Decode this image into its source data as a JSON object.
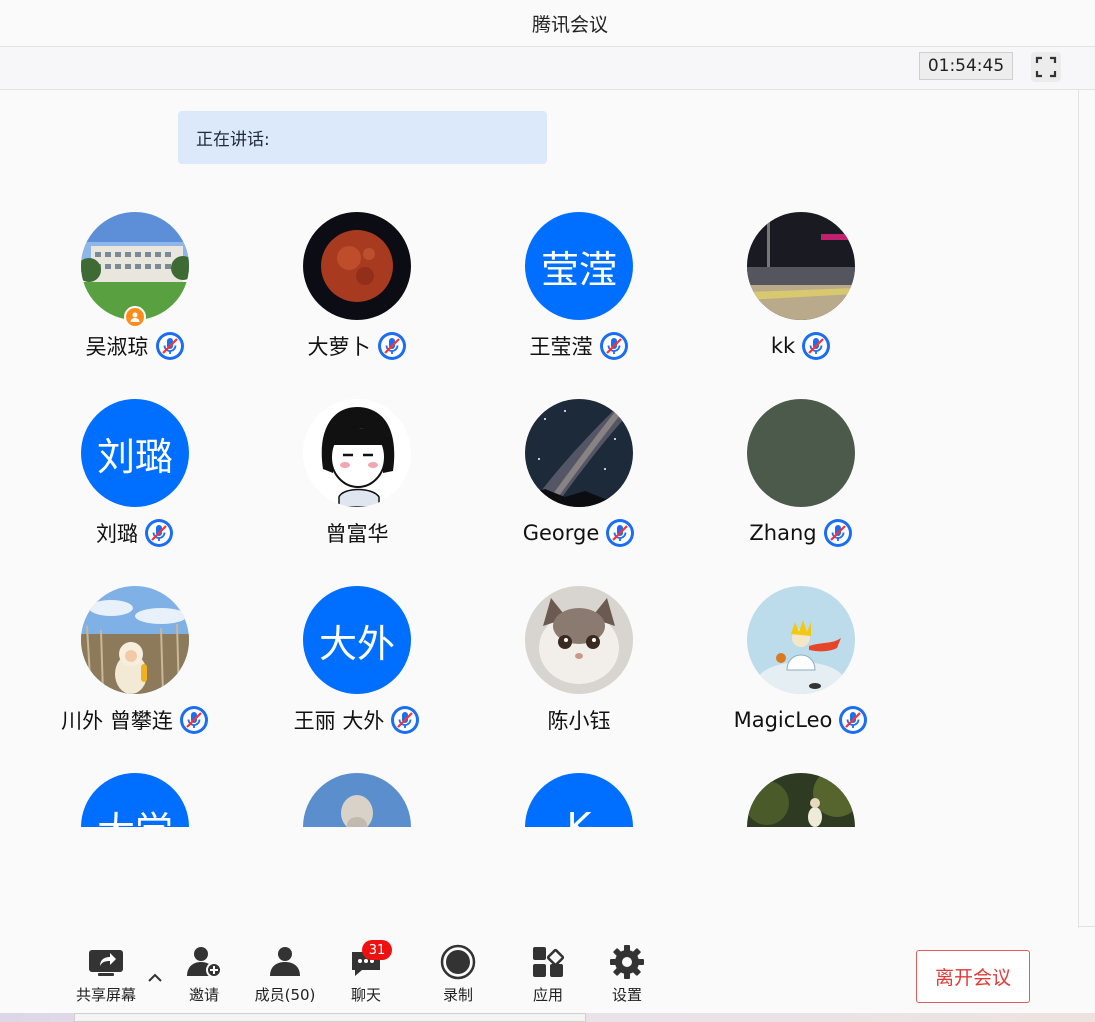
{
  "window": {
    "title": "腾讯会议"
  },
  "topbar": {
    "timer": "01:54:45"
  },
  "speaking": {
    "label": "正在讲话:"
  },
  "participants": [
    {
      "name": "吴淑琼",
      "avatar": "building-photo",
      "muted": true,
      "host": true
    },
    {
      "name": "大萝卜",
      "avatar": "red-moon-photo",
      "muted": true
    },
    {
      "name": "王莹滢",
      "avatar_text": "莹滢",
      "muted": true
    },
    {
      "name": "kk",
      "avatar": "night-station-photo",
      "muted": true
    },
    {
      "name": "刘璐",
      "avatar_text": "刘璐",
      "muted": true
    },
    {
      "name": "曾富华",
      "avatar": "cartoon-girl-drawing",
      "muted": false
    },
    {
      "name": "George",
      "avatar": "milky-way-photo",
      "muted": true
    },
    {
      "name": "Zhang",
      "avatar": "dark-green-solid",
      "muted": true
    },
    {
      "name": "川外 曾攀连",
      "avatar": "child-reeds-photo",
      "muted": true
    },
    {
      "name": "王丽 大外",
      "avatar_text": "大外",
      "muted": true
    },
    {
      "name": "陈小钰",
      "avatar": "cat-photo",
      "muted": false
    },
    {
      "name": "MagicLeo",
      "avatar": "little-prince-drawing",
      "muted": true
    },
    {
      "name": "",
      "avatar_text": "大学",
      "muted": false
    },
    {
      "name": "",
      "avatar": "statue-photo",
      "muted": false
    },
    {
      "name": "",
      "avatar_text": "K",
      "muted": false
    },
    {
      "name": "",
      "avatar": "forest-photo",
      "muted": false
    }
  ],
  "toolbar": {
    "share": "共享屏幕",
    "invite": "邀请",
    "members": "成员(50)",
    "chat": "聊天",
    "chat_badge": "31",
    "record": "录制",
    "apps": "应用",
    "settings": "设置",
    "leave": "离开会议"
  },
  "colors": {
    "accent": "#006eff",
    "leave_red": "#e03a3a",
    "badge_red": "#ee1111"
  }
}
